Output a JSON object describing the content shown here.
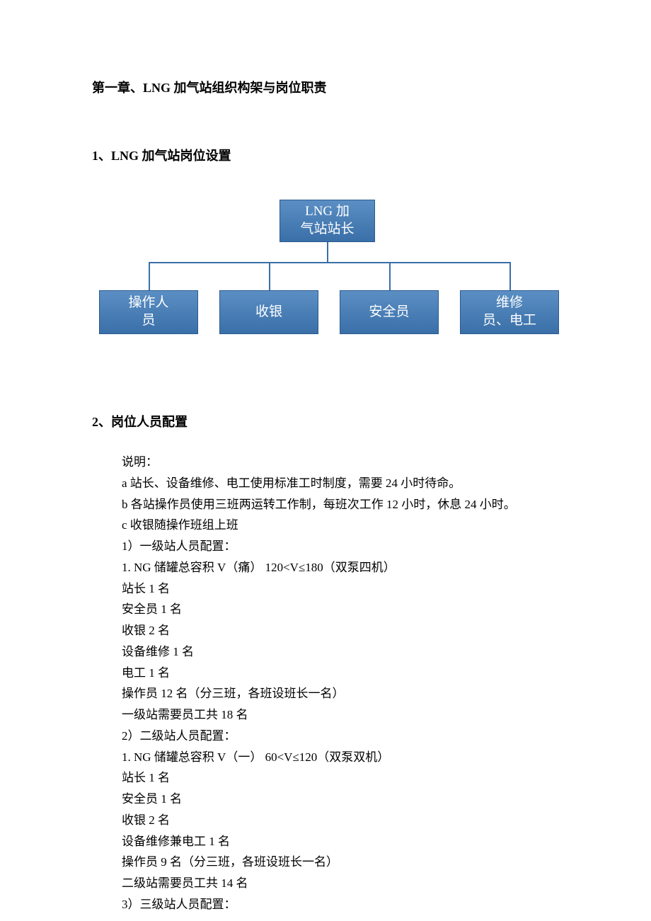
{
  "chapter_title": "第一章、LNG 加气站组织构架与岗位职责",
  "section1_title": "1、LNG 加气站岗位设置",
  "section2_title": "2、岗位人员配置",
  "org": {
    "top_line1": "LNG 加",
    "top_line2": "气站站长",
    "child1_line1": "操作人",
    "child1_line2": "员",
    "child2": "收银",
    "child3": "安全员",
    "child4_line1": "维修",
    "child4_line2": "员、电工"
  },
  "body": {
    "p0": "说明：",
    "p1": "a 站长、设备维修、电工使用标准工时制度，需要 24 小时待命。",
    "p2": "b 各站操作员使用三班两运转工作制，每班次工作 12 小时，休息 24 小时。",
    "p3": "c 收银随操作班组上班",
    "p4": "1）一级站人员配置：",
    "p5": "1. NG 储罐总容积 V（痛） 120<V≤180（双泵四机）",
    "p6": "站长 1 名",
    "p7": "安全员 1 名",
    "p8": "收银 2 名",
    "p9": "设备维修 1 名",
    "p10": "电工 1 名",
    "p11": "操作员 12 名（分三班，各班设班长一名）",
    "p12": "一级站需要员工共 18 名",
    "p13": "2）二级站人员配置：",
    "p14": "1. NG 储罐总容积 V（一） 60<V≤120（双泵双机）",
    "p15": "站长 1 名",
    "p16": "安全员 1 名",
    "p17": "收银 2 名",
    "p18": "设备维修兼电工 1 名",
    "p19": "操作员 9 名（分三班，各班设班长一名）",
    "p20": "二级站需要员工共 14 名",
    "p21": "3）三级站人员配置："
  }
}
